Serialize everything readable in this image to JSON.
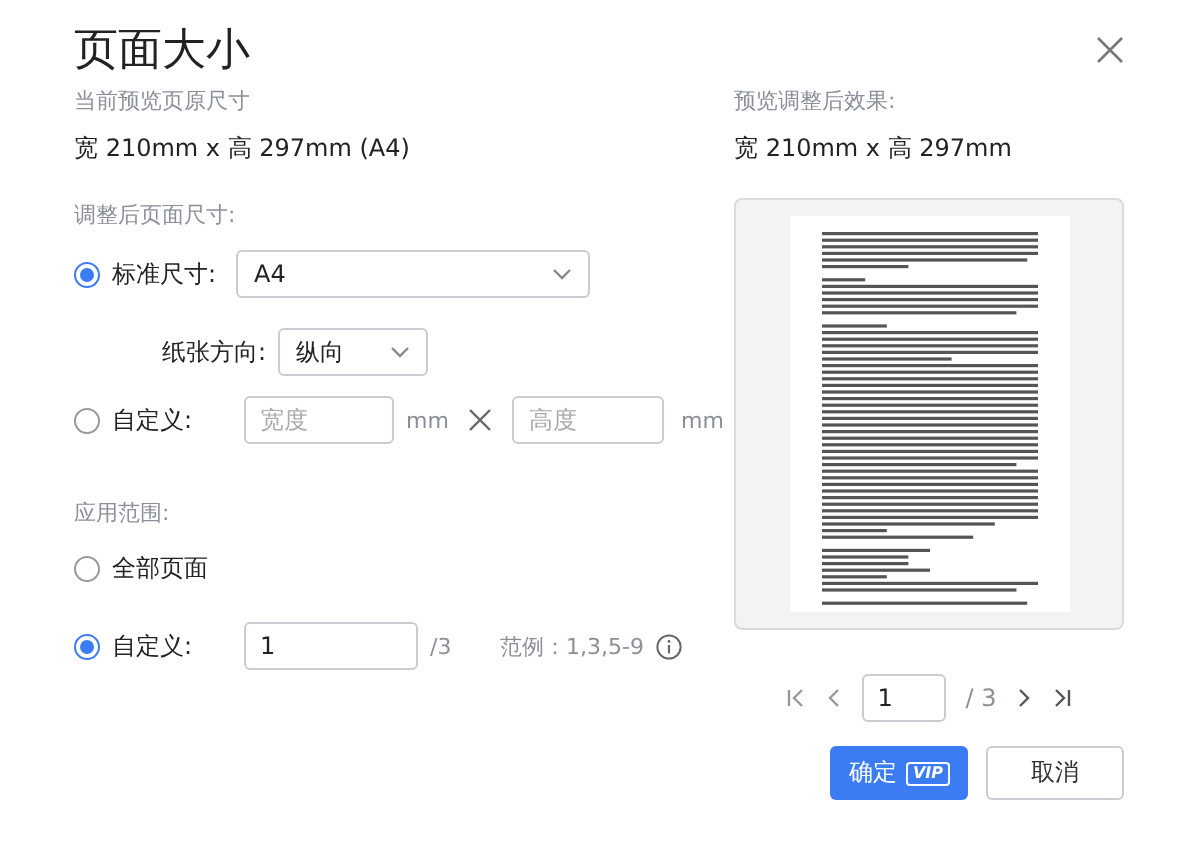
{
  "dialog": {
    "title": "页面大小"
  },
  "original": {
    "label": "当前预览页原尺寸",
    "size": "宽 210mm x 高 297mm (A4)"
  },
  "adjusted": {
    "label": "调整后页面尺寸:",
    "size_options": [
      {
        "kind": "standard",
        "label": "标准尺寸:",
        "selected": true,
        "value": "A4",
        "orientation_label": "纸张方向:",
        "orientation_value": "纵向"
      },
      {
        "kind": "custom",
        "label": "自定义:",
        "selected": false,
        "width_placeholder": "宽度",
        "width_unit": "mm",
        "height_placeholder": "高度",
        "height_unit": "mm"
      }
    ]
  },
  "scope": {
    "label": "应用范围:",
    "options": [
      {
        "kind": "all",
        "label": "全部页面",
        "selected": false
      },
      {
        "kind": "custom",
        "label": "自定义:",
        "selected": true,
        "value": "1",
        "total": "/3",
        "hint": "范例：1,3,5-9"
      }
    ]
  },
  "preview": {
    "label": "预览调整后效果:",
    "size": "宽 210mm x 高 297mm"
  },
  "pagination": {
    "value": "1",
    "total": "/ 3"
  },
  "buttons": [
    {
      "kind": "primary",
      "label": "确定",
      "badge": "VIP"
    },
    {
      "kind": "secondary",
      "label": "取消"
    }
  ]
}
